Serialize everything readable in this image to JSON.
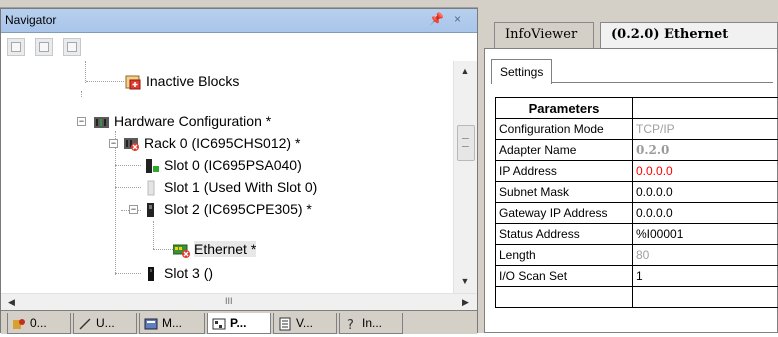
{
  "navigator": {
    "title": "Navigator",
    "pin_glyph": "✂",
    "tree": [
      {
        "label": "Inactive Blocks",
        "icon": "inactive-blocks-icon"
      },
      {
        "label": "Hardware Configuration *",
        "icon": "hardware-config-icon"
      },
      {
        "label": "Rack 0 (IC695CHS012) *",
        "icon": "rack-icon"
      },
      {
        "label": "Slot 0 (IC695PSA040)",
        "icon": "power-supply-icon"
      },
      {
        "label": "Slot 1 (Used With Slot 0)",
        "icon": "slot-used-icon"
      },
      {
        "label": "Slot 2 (IC695CPE305) *",
        "icon": "cpu-icon"
      },
      {
        "label": "Ethernet *",
        "icon": "ethernet-error-icon"
      },
      {
        "label": "Slot 3 ()",
        "icon": "empty-slot-icon"
      }
    ],
    "tabs": [
      {
        "label": "0...",
        "icon": "project-icon"
      },
      {
        "label": "U...",
        "icon": "utilities-icon"
      },
      {
        "label": "M...",
        "icon": "manager-icon"
      },
      {
        "label": "P...",
        "icon": "project-tab-icon"
      },
      {
        "label": "V...",
        "icon": "variables-icon"
      },
      {
        "label": "In...",
        "icon": "help-icon"
      }
    ],
    "scroll_grip": "III"
  },
  "document_tabs": [
    {
      "label": "InfoViewer"
    },
    {
      "label": "(0.2.0) Ethernet"
    }
  ],
  "settings_tab": "Settings",
  "grid": {
    "header": "Parameters",
    "rows": [
      {
        "key": "Configuration Mode",
        "value": "TCP/IP",
        "style": "gray"
      },
      {
        "key": "Adapter Name",
        "value": "0.2.0",
        "style": "serif"
      },
      {
        "key": "IP Address",
        "value": "0.0.0.0",
        "style": "red"
      },
      {
        "key": "Subnet Mask",
        "value": "0.0.0.0",
        "style": "norm"
      },
      {
        "key": "Gateway IP Address",
        "value": "0.0.0.0",
        "style": "norm"
      },
      {
        "key": "Status Address",
        "value": "%I00001",
        "style": "norm"
      },
      {
        "key": "Length",
        "value": "80",
        "style": "gray"
      },
      {
        "key": "I/O Scan Set",
        "value": "1",
        "style": "norm"
      },
      {
        "key": "",
        "value": "",
        "style": "norm"
      }
    ]
  },
  "colors": {
    "title_bar": "#b7d0ee",
    "error_red": "#ff0000",
    "chrome": "#d4d0c8"
  }
}
